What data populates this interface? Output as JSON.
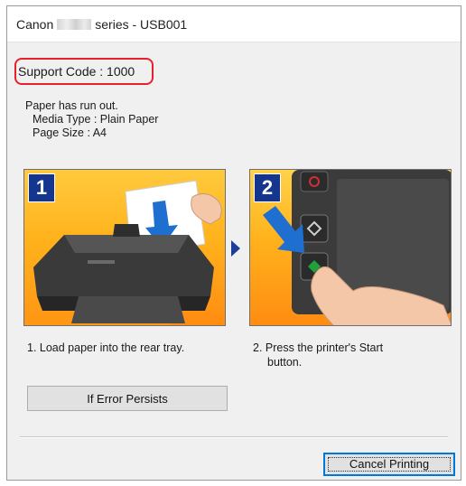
{
  "window": {
    "title_prefix": "Canon",
    "title_suffix": "series - USB001"
  },
  "support": {
    "code_text": "Support Code : 1000"
  },
  "message": {
    "line1": "Paper has run out.",
    "line2": "Media Type : Plain Paper",
    "line3": "Page Size : A4"
  },
  "steps": [
    {
      "number": "1",
      "caption": "1.  Load paper into the rear tray."
    },
    {
      "number": "2",
      "caption_line1": "2.  Press the printer's Start",
      "caption_line2": "button."
    }
  ],
  "buttons": {
    "if_error_persists": "If Error Persists",
    "cancel_printing": "Cancel Printing"
  },
  "colors": {
    "highlight_border": "#e8202c",
    "step_badge": "#15368f",
    "illustration_bg": "#ffb21c",
    "focus_border": "#0078d7"
  }
}
